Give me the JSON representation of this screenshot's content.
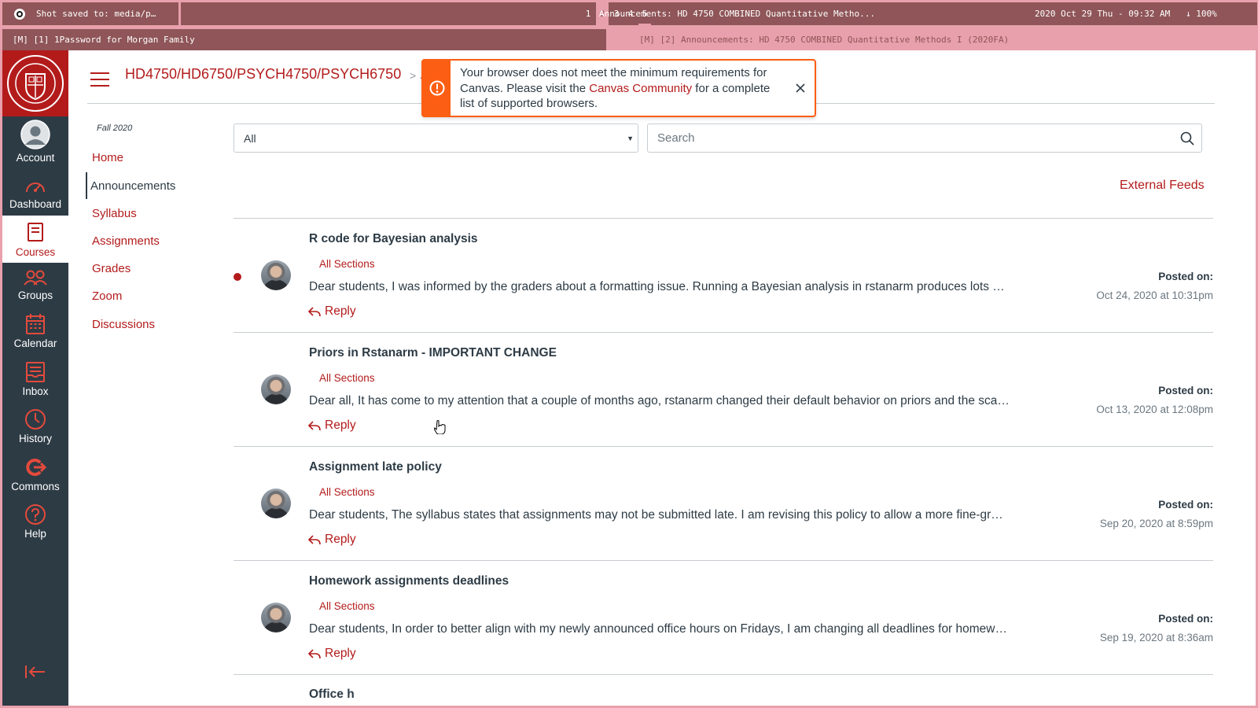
{
  "wm": {
    "screenshot_notice": "Shot saved to: media/p…",
    "workspaces": [
      "1",
      "2",
      "3",
      "4",
      "5"
    ],
    "active_workspace": "2",
    "window_title": "Announcements: HD 4750 COMBINED Quantitative Metho...",
    "clock": "2020 Oct 29 Thu - 09:32 AM",
    "battery": "↓ 100%"
  },
  "tabs": [
    {
      "label": "[M]  [1] 1Password for Morgan Family"
    },
    {
      "label": "[M]  [2] Announcements: HD 4750 COMBINED Quantitative Methods I (2020FA)"
    }
  ],
  "global_nav": {
    "items": [
      {
        "label": "Account",
        "icon": "avatar-icon"
      },
      {
        "label": "Dashboard",
        "icon": "dashboard-icon"
      },
      {
        "label": "Courses",
        "icon": "courses-icon",
        "active": true
      },
      {
        "label": "Groups",
        "icon": "groups-icon"
      },
      {
        "label": "Calendar",
        "icon": "calendar-icon"
      },
      {
        "label": "Inbox",
        "icon": "inbox-icon"
      },
      {
        "label": "History",
        "icon": "history-icon"
      },
      {
        "label": "Commons",
        "icon": "commons-icon"
      },
      {
        "label": "Help",
        "icon": "help-icon"
      }
    ]
  },
  "header": {
    "breadcrumb": "HD4750/HD6750/PSYCH4750/PSYCH6750",
    "breadcrumb_separator": ">",
    "breadcrumb_current_fragment": "A"
  },
  "alert": {
    "text_before": "Your browser does not meet the minimum requirements for Canvas. Please visit the ",
    "link": "Canvas Community",
    "text_after": " for a complete list of supported browsers."
  },
  "course_nav": {
    "term": "Fall 2020",
    "items": [
      {
        "label": "Home"
      },
      {
        "label": "Announcements",
        "active": true
      },
      {
        "label": "Syllabus"
      },
      {
        "label": "Assignments"
      },
      {
        "label": "Grades"
      },
      {
        "label": "Zoom"
      },
      {
        "label": "Discussions"
      }
    ]
  },
  "filters": {
    "section_value": "All",
    "search_placeholder": "Search"
  },
  "external_feeds": "External Feeds",
  "announcements": [
    {
      "title": "R code for Bayesian analysis",
      "sections": "All Sections",
      "body": "Dear students,  I was informed by the graders about a formatting issue. Running a Bayesian analysis in rstanarm produces lots …",
      "reply": "Reply",
      "posted_label": "Posted on:",
      "date": "Oct 24, 2020 at 10:31pm",
      "unread": true
    },
    {
      "title": "Priors in Rstanarm - IMPORTANT CHANGE",
      "sections": "All Sections",
      "body": "Dear all, It has come to my attention that a couple of months ago, rstanarm changed their default behavior on priors and the sca…",
      "reply": "Reply",
      "posted_label": "Posted on:",
      "date": "Oct 13, 2020 at 12:08pm",
      "unread": false
    },
    {
      "title": "Assignment late policy",
      "sections": "All Sections",
      "body": "Dear students, The syllabus states that assignments may not be submitted late.  I am revising this policy to allow a more fine-gr…",
      "reply": "Reply",
      "posted_label": "Posted on:",
      "date": "Sep 20, 2020 at 8:59pm",
      "unread": false
    },
    {
      "title": "Homework assignments deadlines",
      "sections": "All Sections",
      "body": "Dear students, In order to better align with my newly announced office hours on Fridays, I am changing all deadlines for homew…",
      "reply": "Reply",
      "posted_label": "Posted on:",
      "date": "Sep 19, 2020 at 8:36am",
      "unread": false
    }
  ],
  "partial_announcement_title": "Office h",
  "colors": {
    "brand": "#b31b1b",
    "nav_bg": "#2d3b45",
    "warning": "#fc5e13",
    "wm_dark": "#8f5558",
    "wm_light": "#e8a0ac"
  }
}
